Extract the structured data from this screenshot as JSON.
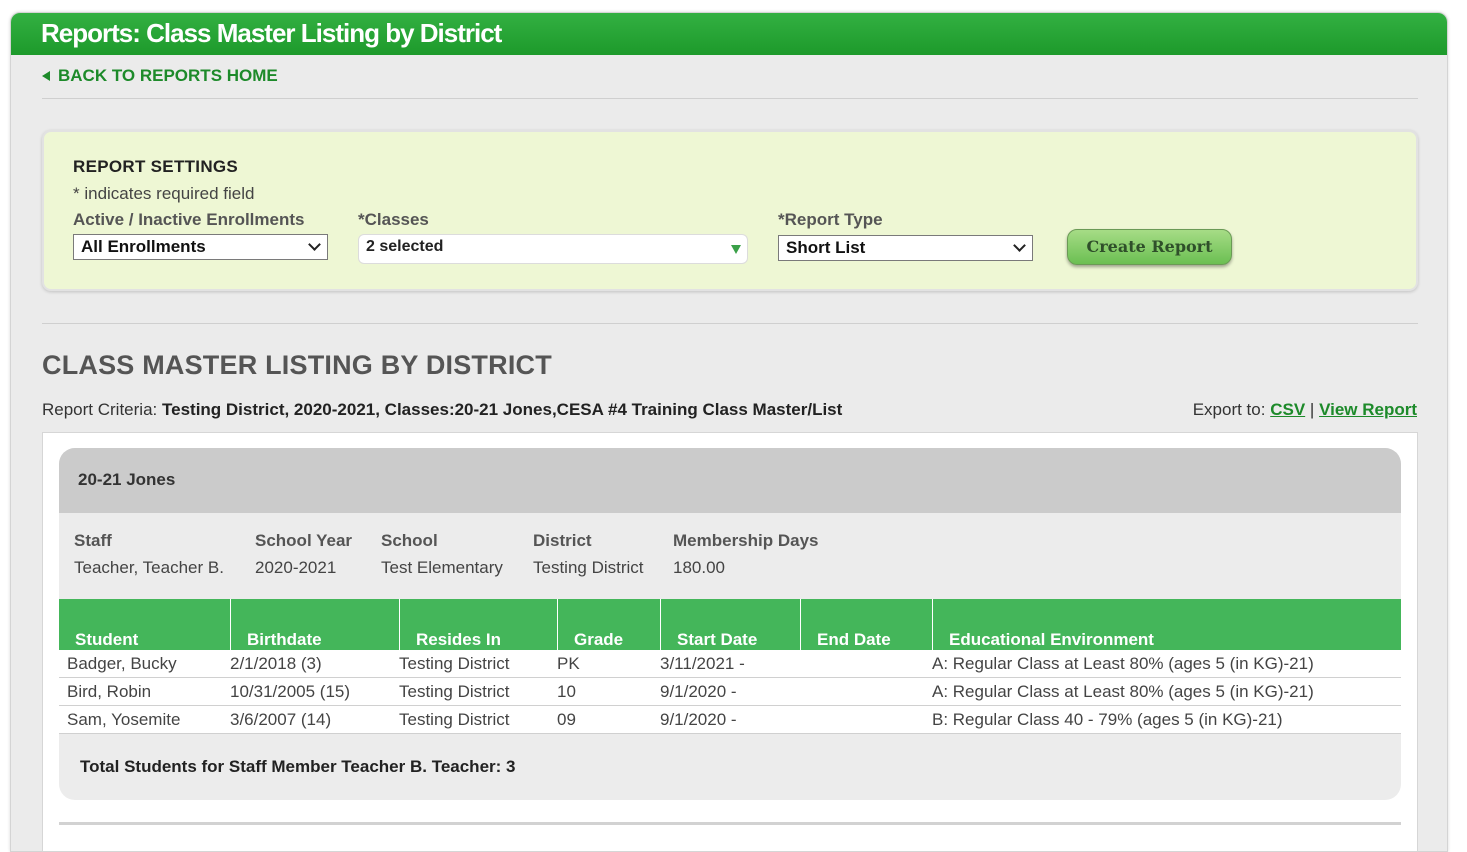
{
  "title": "Reports: Class Master Listing by District",
  "back_link": "BACK TO REPORTS HOME",
  "settings": {
    "title": "REPORT SETTINGS",
    "note": "* indicates required field",
    "enrollments_label": "Active / Inactive Enrollments",
    "enrollments_value": "All Enrollments",
    "classes_label": "*Classes",
    "classes_value": "2 selected",
    "report_type_label": "*Report Type",
    "report_type_value": "Short List",
    "create_button": "Create Report"
  },
  "report": {
    "heading": "CLASS MASTER LISTING BY DISTRICT",
    "criteria_label": "Report Criteria:",
    "criteria_value": "Testing District, 2020-2021, Classes:20-21 Jones,CESA #4 Training Class Master/List",
    "export_label": "Export to:",
    "export_csv": "CSV",
    "export_sep": "|",
    "export_view": "View Report"
  },
  "class_block": {
    "name": "20-21 Jones",
    "info": {
      "staff_h": "Staff",
      "staff_v": "Teacher, Teacher B.",
      "year_h": "School Year",
      "year_v": "2020-2021",
      "school_h": "School",
      "school_v": "Test Elementary",
      "district_h": "District",
      "district_v": "Testing District",
      "days_h": "Membership Days",
      "days_v": "180.00"
    },
    "columns": [
      "Student",
      "Birthdate",
      "Resides In",
      "Grade",
      "Start Date",
      "End Date",
      "Educational Environment"
    ],
    "rows": [
      {
        "student": "Badger, Bucky",
        "birthdate": "2/1/2018 (3)",
        "resides": "Testing District",
        "grade": "PK",
        "start": "3/11/2021 -",
        "end": "",
        "env": "A: Regular Class at Least 80% (ages 5 (in KG)-21)"
      },
      {
        "student": "Bird, Robin",
        "birthdate": "10/31/2005 (15)",
        "resides": "Testing District",
        "grade": "10",
        "start": "9/1/2020 -",
        "end": "",
        "env": "A: Regular Class at Least 80% (ages 5 (in KG)-21)"
      },
      {
        "student": "Sam, Yosemite",
        "birthdate": "3/6/2007 (14)",
        "resides": "Testing District",
        "grade": "09",
        "start": "9/1/2020 -",
        "end": "",
        "env": "B: Regular Class 40 - 79% (ages 5 (in KG)-21)"
      }
    ],
    "total": "Total Students for Staff Member Teacher B. Teacher: 3"
  }
}
